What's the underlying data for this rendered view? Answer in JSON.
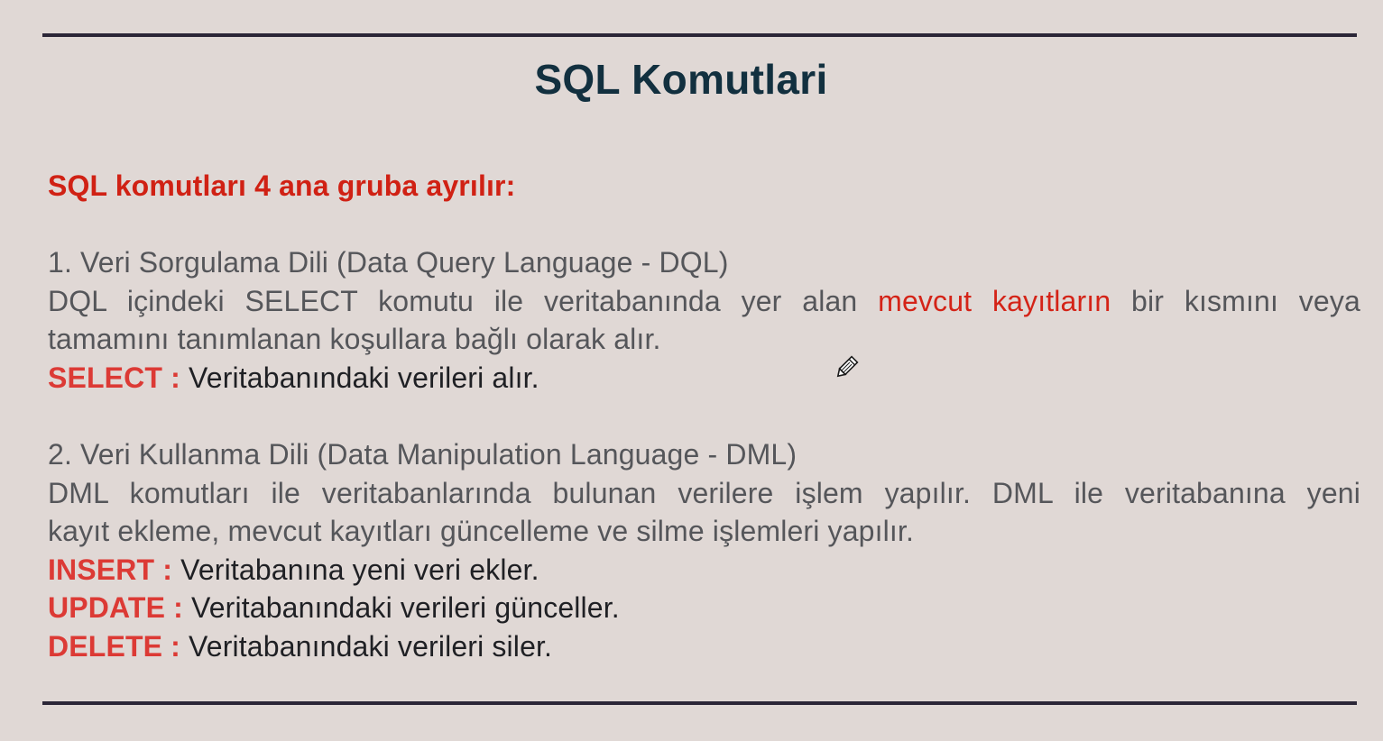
{
  "title": "SQL Komutlari",
  "intro": "SQL komutları 4 ana gruba ayrılır:",
  "sections": [
    {
      "heading": "1. Veri Sorgulama Dili (Data Query Language - DQL)",
      "desc_line1_before": "DQL içindeki SELECT komutu ile veritabanında yer alan ",
      "desc_line1_highlight": "mevcut kayıtların",
      "desc_line1_after": " bir kısmını  veya",
      "desc_line2": "tamamını tanımlanan koşullara bağlı olarak alır.",
      "commands": [
        {
          "name": "SELECT :",
          "text": " Veritabanındaki verileri alır."
        }
      ]
    },
    {
      "heading": "2. Veri Kullanma Dili (Data Manipulation Language - DML)",
      "desc_line1": "DML komutları ile veritabanlarında bulunan verilere işlem yapılır. DML ile veritabanına yeni",
      "desc_line2": "kayıt ekleme, mevcut kayıtları güncelleme ve silme işlemleri yapılır.",
      "commands": [
        {
          "name": "INSERT :",
          "text": " Veritabanına yeni veri ekler."
        },
        {
          "name": "UPDATE :",
          "text": " Veritabanındaki verileri günceller."
        },
        {
          "name": "DELETE :",
          "text": " Veritabanındaki verileri siler."
        }
      ]
    }
  ],
  "colors": {
    "background": "#e0d8d5",
    "rule": "#2b2637",
    "title": "#12303f",
    "accent_red": "#d02114",
    "body_text": "#55565a",
    "command_text": "#1f2024"
  },
  "icons": {
    "cursor": "pencil-cursor-icon"
  }
}
